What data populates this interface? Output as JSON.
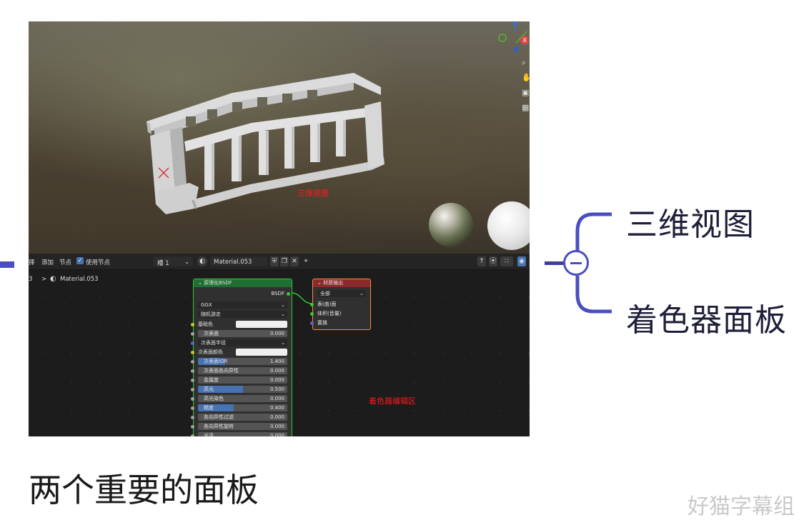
{
  "viewport": {
    "label": "三维视图",
    "nav_icons": [
      "magnifier-icon",
      "hand-icon",
      "camera-icon",
      "grid-icon"
    ]
  },
  "node_editor": {
    "header": {
      "select_partial": "择",
      "add": "添加",
      "node": "节点",
      "use_nodes": "使用节点",
      "slot": "槽 1",
      "material_name": "Material.053"
    },
    "breadcrumb": {
      "prefix": "3",
      "separator": ">",
      "material": "Material.053"
    },
    "label": "着色器编辑区",
    "bsdf_node": {
      "title": "原理化BSDF",
      "output": "BSDF",
      "distribution": "GGX",
      "subsurface_method": "随机游走",
      "rows": [
        {
          "label": "基础色",
          "value": "",
          "kind": "color",
          "socket": "#c7c729"
        },
        {
          "label": "次表面",
          "value": "0.000",
          "kind": "field",
          "fill": 0,
          "socket": "#a1a1a1"
        },
        {
          "label": "次表面半径",
          "value": "",
          "kind": "dropdown",
          "socket": "#6363c7"
        },
        {
          "label": "次表面颜色",
          "value": "",
          "kind": "color",
          "socket": "#c7c729"
        },
        {
          "label": "次表面IOR",
          "value": "1.400",
          "kind": "field",
          "fill": 0.3,
          "socket": "#a1a1a1"
        },
        {
          "label": "次表面各向异性",
          "value": "0.000",
          "kind": "field",
          "fill": 0,
          "socket": "#a1a1a1"
        },
        {
          "label": "金属度",
          "value": "0.000",
          "kind": "field",
          "fill": 0,
          "socket": "#a1a1a1"
        },
        {
          "label": "高光",
          "value": "0.500",
          "kind": "field",
          "fill": 0.5,
          "socket": "#a1a1a1"
        },
        {
          "label": "高光染色",
          "value": "0.000",
          "kind": "field",
          "fill": 0,
          "socket": "#a1a1a1"
        },
        {
          "label": "糙度",
          "value": "0.400",
          "kind": "field",
          "fill": 0.4,
          "socket": "#a1a1a1"
        },
        {
          "label": "各向异性过滤",
          "value": "0.000",
          "kind": "field",
          "fill": 0,
          "socket": "#a1a1a1"
        },
        {
          "label": "各向异性旋转",
          "value": "0.000",
          "kind": "field",
          "fill": 0,
          "socket": "#a1a1a1"
        },
        {
          "label": "光泽",
          "value": "0.000",
          "kind": "field",
          "fill": 0,
          "socket": "#a1a1a1"
        }
      ]
    },
    "output_node": {
      "title": "材质输出",
      "target": "全部",
      "inputs": [
        {
          "label": "表(曲)面",
          "socket": "#33c833"
        },
        {
          "label": "体积(音量)",
          "socket": "#33c833"
        },
        {
          "label": "置换",
          "socket": "#6363c7"
        }
      ]
    }
  },
  "mindmap": {
    "branch_top": "三维视图",
    "branch_bottom": "着色器面板",
    "accent": "#4a4ec0"
  },
  "footer": {
    "title": "两个重要的面板",
    "watermark": "好猫字幕组"
  }
}
